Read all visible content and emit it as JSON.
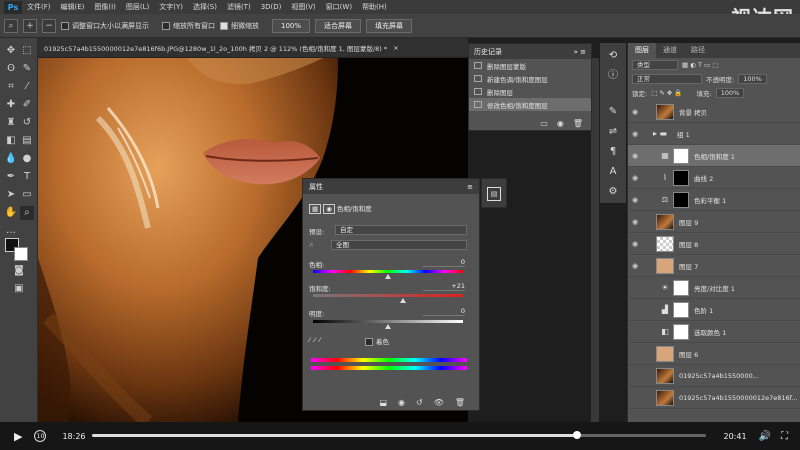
{
  "app": {
    "logo": "Ps",
    "menu": [
      "文件(F)",
      "编辑(E)",
      "图像(I)",
      "图层(L)",
      "文字(Y)",
      "选择(S)",
      "滤镜(T)",
      "3D(D)",
      "视图(V)",
      "窗口(W)",
      "帮助(H)"
    ],
    "watermark": "视达网"
  },
  "options": {
    "resize_window": "调整窗口大小以满屏显示",
    "zoom_all": "缩放所有窗口",
    "scrubby_zoom": "细微缩放",
    "zoom_value": "100%",
    "fit_screen": "适合屏幕",
    "fill_screen": "填充屏幕"
  },
  "document": {
    "tab_title": "01925c57a4b1550000012e7e816f6b.JPG@1280w_1l_2o_100h 拷贝 2 @ 112% (色相/饱和度 1, 图层蒙版/8) *",
    "close": "×"
  },
  "history": {
    "title": "历史记录",
    "menu_glyph": "≡",
    "collapse": "»",
    "items": [
      "删除图层蒙版",
      "新建色调/饱和度图层",
      "删除图层",
      "修改色相/饱和度图层"
    ]
  },
  "properties": {
    "title": "属性",
    "panel_name": "色相/饱和度",
    "preset_label": "预设:",
    "preset_value": "自定",
    "channel_value": "全图",
    "hue_label": "色相:",
    "hue_value": "0",
    "saturation_label": "饱和度:",
    "saturation_value": "+21",
    "lightness_label": "明度:",
    "lightness_value": "0",
    "colorize_label": "着色",
    "hue_fraction": 0.5,
    "saturation_fraction": 0.6,
    "lightness_fraction": 0.5
  },
  "layers": {
    "tabs": [
      "图层",
      "通道",
      "路径"
    ],
    "filter_label": "类型",
    "blend_mode": "正常",
    "opacity_label": "不透明度:",
    "opacity_value": "100%",
    "lock_label": "锁定:",
    "fill_label": "填充:",
    "fill_value": "100%",
    "items": [
      {
        "name": "背景 拷贝",
        "kind": "photo",
        "visible": true,
        "selected": false
      },
      {
        "name": "组 1",
        "kind": "group",
        "visible": true,
        "selected": false
      },
      {
        "name": "色相/饱和度 1",
        "kind": "adjust-hue",
        "visible": true,
        "selected": true
      },
      {
        "name": "曲线 2",
        "kind": "adjust-curves",
        "visible": true,
        "selected": false
      },
      {
        "name": "色彩平衡 1",
        "kind": "adjust-balance",
        "visible": true,
        "selected": false
      },
      {
        "name": "图层 9",
        "kind": "photo",
        "visible": true,
        "selected": false
      },
      {
        "name": "图层 8",
        "kind": "checker",
        "visible": true,
        "selected": false
      },
      {
        "name": "图层 7",
        "kind": "skin",
        "visible": true,
        "selected": false
      },
      {
        "name": "亮度/对比度 1",
        "kind": "adjust-bright",
        "visible": false,
        "selected": false
      },
      {
        "name": "色阶 1",
        "kind": "adjust-levels",
        "visible": false,
        "selected": false
      },
      {
        "name": "选取颜色 1",
        "kind": "adjust-selective",
        "visible": false,
        "selected": false
      },
      {
        "name": "图层 6",
        "kind": "skin",
        "visible": false,
        "selected": false
      },
      {
        "name": "01925c57a4b1550000...",
        "kind": "photo",
        "visible": false,
        "selected": false
      },
      {
        "name": "01925c57a4b1550000012e7e816f...",
        "kind": "photo",
        "visible": false,
        "selected": false
      }
    ]
  },
  "player": {
    "current_time": "18:26",
    "total_time": "20:41",
    "progress": 0.79
  }
}
